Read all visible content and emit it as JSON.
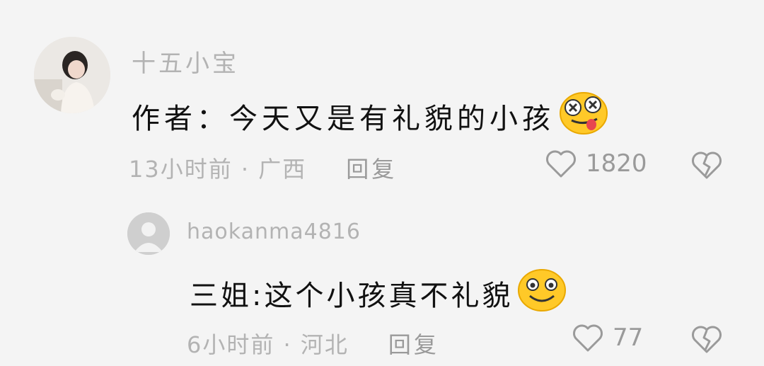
{
  "comments": [
    {
      "username": "十五小宝",
      "text": "作者：今天又是有礼貌的小孩",
      "emoji_icon": "star-struck-tongue-emoji",
      "time_location": "13小时前 · 广西",
      "reply_label": "回复",
      "likes": "1820"
    }
  ],
  "reply": {
    "username": "haokanma4816",
    "text": "三姐:这个小孩真不礼貌",
    "emoji_icon": "smiling-face-emoji",
    "time_location": "6小时前 · 河北",
    "reply_label": "回复",
    "likes": "77"
  },
  "colors": {
    "background": "#f4f4f4",
    "muted_text": "#b3b3b3",
    "icon_gray": "#9a9a9a",
    "emoji_yellow": "#ffc928"
  }
}
